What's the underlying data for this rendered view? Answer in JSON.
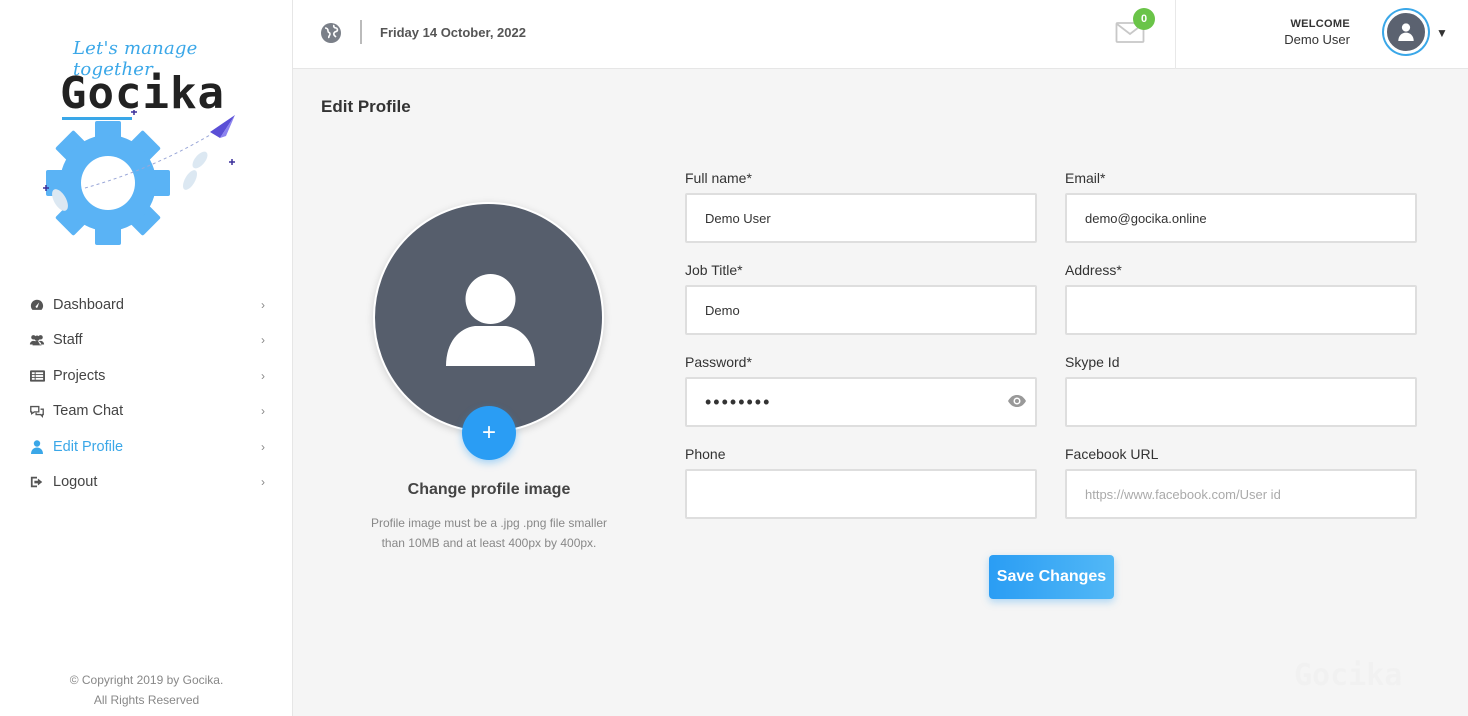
{
  "sidebar": {
    "tagline": "Let's manage together",
    "brand": "Gocika",
    "nav": [
      {
        "label": "Dashboard",
        "icon": "dashboard-icon",
        "active": false
      },
      {
        "label": "Staff",
        "icon": "users-icon",
        "active": false
      },
      {
        "label": "Projects",
        "icon": "projects-icon",
        "active": false
      },
      {
        "label": "Team Chat",
        "icon": "chat-icon",
        "active": false
      },
      {
        "label": "Edit Profile",
        "icon": "user-icon",
        "active": true
      },
      {
        "label": "Logout",
        "icon": "logout-icon",
        "active": false
      }
    ],
    "copyright_line1": "© Copyright 2019 by Gocika.",
    "copyright_line2": "All Rights Reserved"
  },
  "header": {
    "date": "Friday 14 October, 2022",
    "mail_count": "0",
    "welcome": "WELCOME",
    "user_name": "Demo User"
  },
  "main": {
    "title": "Edit Profile",
    "change_image": "Change profile image",
    "image_help": "Profile image must be a .jpg .png file smaller than 10MB and at least 400px by 400px.",
    "fields": {
      "full_name": {
        "label": "Full name*",
        "value": ""
      },
      "email": {
        "label": "Email*",
        "value": ""
      },
      "job_title": {
        "label": "Job Title*",
        "value": ""
      },
      "address": {
        "label": "Address*",
        "value": ""
      },
      "password": {
        "label": "Password*",
        "value": ""
      },
      "skype": {
        "label": "Skype Id",
        "value": ""
      },
      "phone": {
        "label": "Phone",
        "value": ""
      },
      "facebook": {
        "label": "Facebook URL",
        "value": "",
        "placeholder": "https://www.facebook.com/User id"
      }
    },
    "save_label": "Save Changes"
  },
  "values": {
    "full_name": "Demo User",
    "email": "demo@gocika.online",
    "job_title": "Demo",
    "password": "demo1234"
  },
  "watermark": "Gocika",
  "colors": {
    "accent": "#3aa7e8",
    "button": "#2a9df4",
    "badge": "#6ac448",
    "avatar_bg": "#565e6c"
  }
}
